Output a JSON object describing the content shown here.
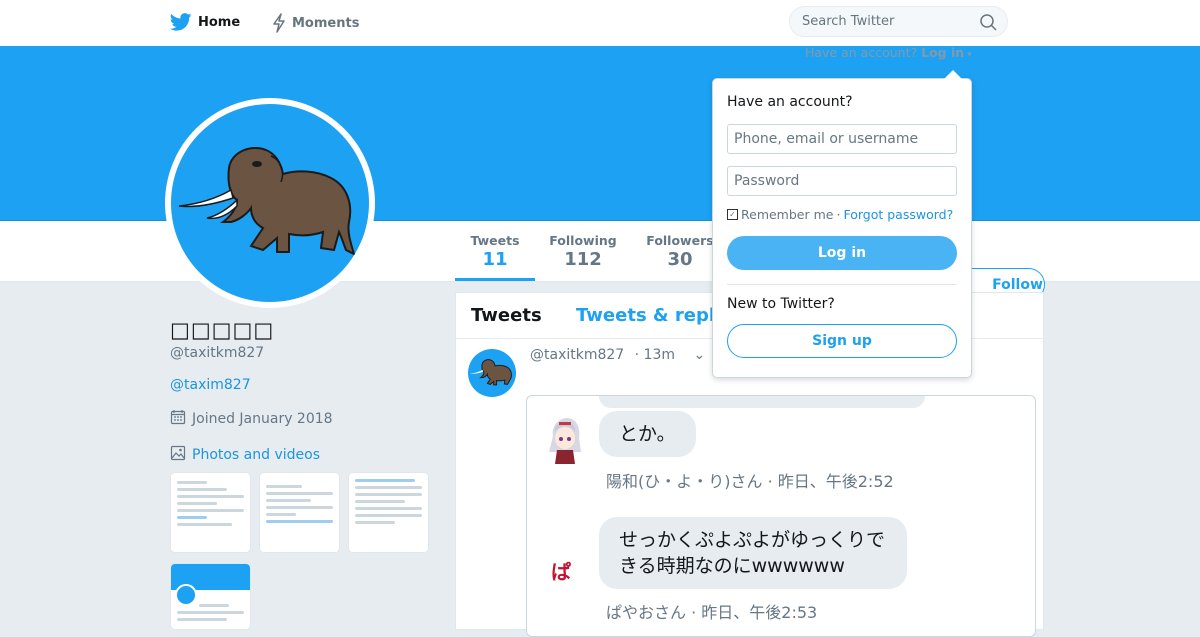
{
  "topnav": {
    "home_label": "Home",
    "moments_label": "Moments"
  },
  "search": {
    "placeholder": "Search Twitter"
  },
  "login_hint": {
    "prefix": "Have an account?",
    "link": "Log in"
  },
  "profile": {
    "display_name": "□□□□□",
    "handle": "@taxitkm827",
    "website": "@taxim827",
    "joined": "Joined January 2018",
    "photos_label": "Photos and videos"
  },
  "stats": [
    {
      "label": "Tweets",
      "value": "11"
    },
    {
      "label": "Following",
      "value": "112"
    },
    {
      "label": "Followers",
      "value": "30"
    }
  ],
  "follow_button": "Follow",
  "timeline": {
    "tab_tweets": "Tweets",
    "tab_replies": "Tweets & replies",
    "tweet_handle": "@taxitkm827",
    "tweet_time": "· 13m",
    "msg1_text": "とか。",
    "msg1_caption": "陽和(ひ・よ・り)さん · 昨日、午後2:52",
    "msg2_avatar_text": "ぱ",
    "msg2_text": "せっかくぷよぷよがゆっくりできる時期なのにwwwwww",
    "msg2_caption": "ぱやおさん · 昨日、午後2:53"
  },
  "login_dropdown": {
    "title": "Have an account?",
    "username_placeholder": "Phone, email or username",
    "password_placeholder": "Password",
    "remember_me": "Remember me",
    "separator": "·",
    "forgot_password": "Forgot password?",
    "login_button": "Log in",
    "new_to_twitter": "New to Twitter?",
    "signup_button": "Sign up"
  },
  "colors": {
    "brand": "#1da1f2",
    "link": "#1b95e0",
    "background": "#e6ecf0"
  },
  "icons": [
    "twitter-bird-icon",
    "moments-bolt-icon",
    "search-icon",
    "calendar-icon",
    "photo-icon",
    "chevron-down-icon"
  ]
}
